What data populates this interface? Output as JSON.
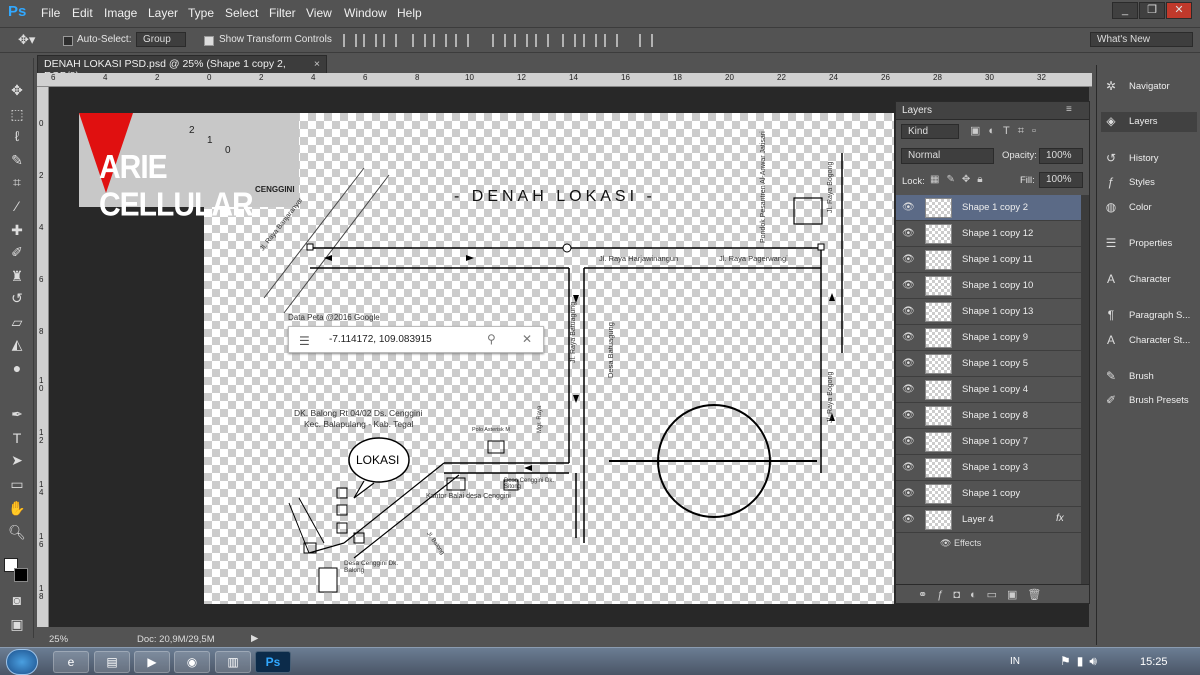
{
  "app": {
    "logo": "Ps"
  },
  "menu": [
    "File",
    "Edit",
    "Image",
    "Layer",
    "Type",
    "Select",
    "Filter",
    "View",
    "Window",
    "Help"
  ],
  "window_controls": {
    "minimize": "_",
    "restore": "❐",
    "close": "✕"
  },
  "options": {
    "auto_select_label": "Auto-Select:",
    "auto_select_value": "Group",
    "show_transform_label": "Show Transform Controls",
    "workspace": "What's New"
  },
  "document": {
    "tab_title": "DENAH LOKASI PSD.psd @ 25% (Shape 1 copy 2, RGB/8)",
    "ruler_top": [
      "6",
      "4",
      "2",
      "0",
      "2",
      "4",
      "6",
      "8",
      "10",
      "12",
      "14",
      "16",
      "18",
      "20",
      "22",
      "24",
      "26",
      "28",
      "30",
      "32"
    ],
    "ruler_left": [
      "0",
      "2",
      "4",
      "6",
      "8",
      "1 0",
      "1 2",
      "1 4",
      "1 6",
      "1 8"
    ],
    "zoom": "25%",
    "doc_size": "Doc: 20,9M/29,5M"
  },
  "canvas": {
    "banner_brand": "ARIE CELLULAR",
    "banner_sub": "CENGGINI",
    "banner_nums": [
      "2",
      "1",
      "0"
    ],
    "title": "- DENAH LOKASI -",
    "data_peta": "Data Peta @2016 Google",
    "search_value": "-7.114172, 109.083915",
    "address_1": "DK. Balong Rt 04/02 Ds. Cenggini",
    "address_2": "Kec. Balapulang - Kab. Tegal",
    "lokasi": "LOKASI",
    "road_banjaranyar": "Jl. Raya Banjaranyar",
    "road_harjawinangun": "Jl. Raya Harjawinangun",
    "road_pagerwangi": "Jl. Raya Pagerwangi",
    "road_batuagung": "Jl. Raya Batuagung",
    "road_bogong_top": "Jl. Raya Bogong",
    "road_bogong_mid": "Jl. Raya Bogong",
    "desa_batuagung": "Desa Batuagung",
    "pondok": "Pondok Pesantren Al-Anwar Jatisari",
    "kantor": "Kantor Balai desa Cenggini",
    "desa_cenggini_1": "Desa Cenggini Dk. Sitong",
    "desa_cenggini_2": "Desa Cenggini Dk. Balong",
    "polo": "Polo Asterisk M",
    "margo": "Mgr. Raya",
    "jl_balong": "Jl. Balong"
  },
  "layers_panel": {
    "title": "Layers",
    "kind": "Kind",
    "blend": "Normal",
    "opacity_label": "Opacity:",
    "opacity": "100%",
    "lock_label": "Lock:",
    "fill_label": "Fill:",
    "fill": "100%",
    "layers": [
      "Shape 1 copy 2",
      "Shape 1 copy 12",
      "Shape 1 copy 11",
      "Shape 1 copy 10",
      "Shape 1 copy 13",
      "Shape 1 copy 9",
      "Shape 1 copy 5",
      "Shape 1 copy 4",
      "Shape 1 copy 8",
      "Shape 1 copy 7",
      "Shape 1 copy 3",
      "Shape 1 copy",
      "Layer 4"
    ],
    "effects": "Effects",
    "fx": "fx"
  },
  "dock": [
    "Navigator",
    "Layers",
    "History",
    "Styles",
    "Color",
    "Properties",
    "Character",
    "Paragraph S...",
    "Character St...",
    "Brush",
    "Brush Presets"
  ],
  "taskbar": {
    "lang": "IN",
    "time": "15:25",
    "ps": "Ps"
  }
}
